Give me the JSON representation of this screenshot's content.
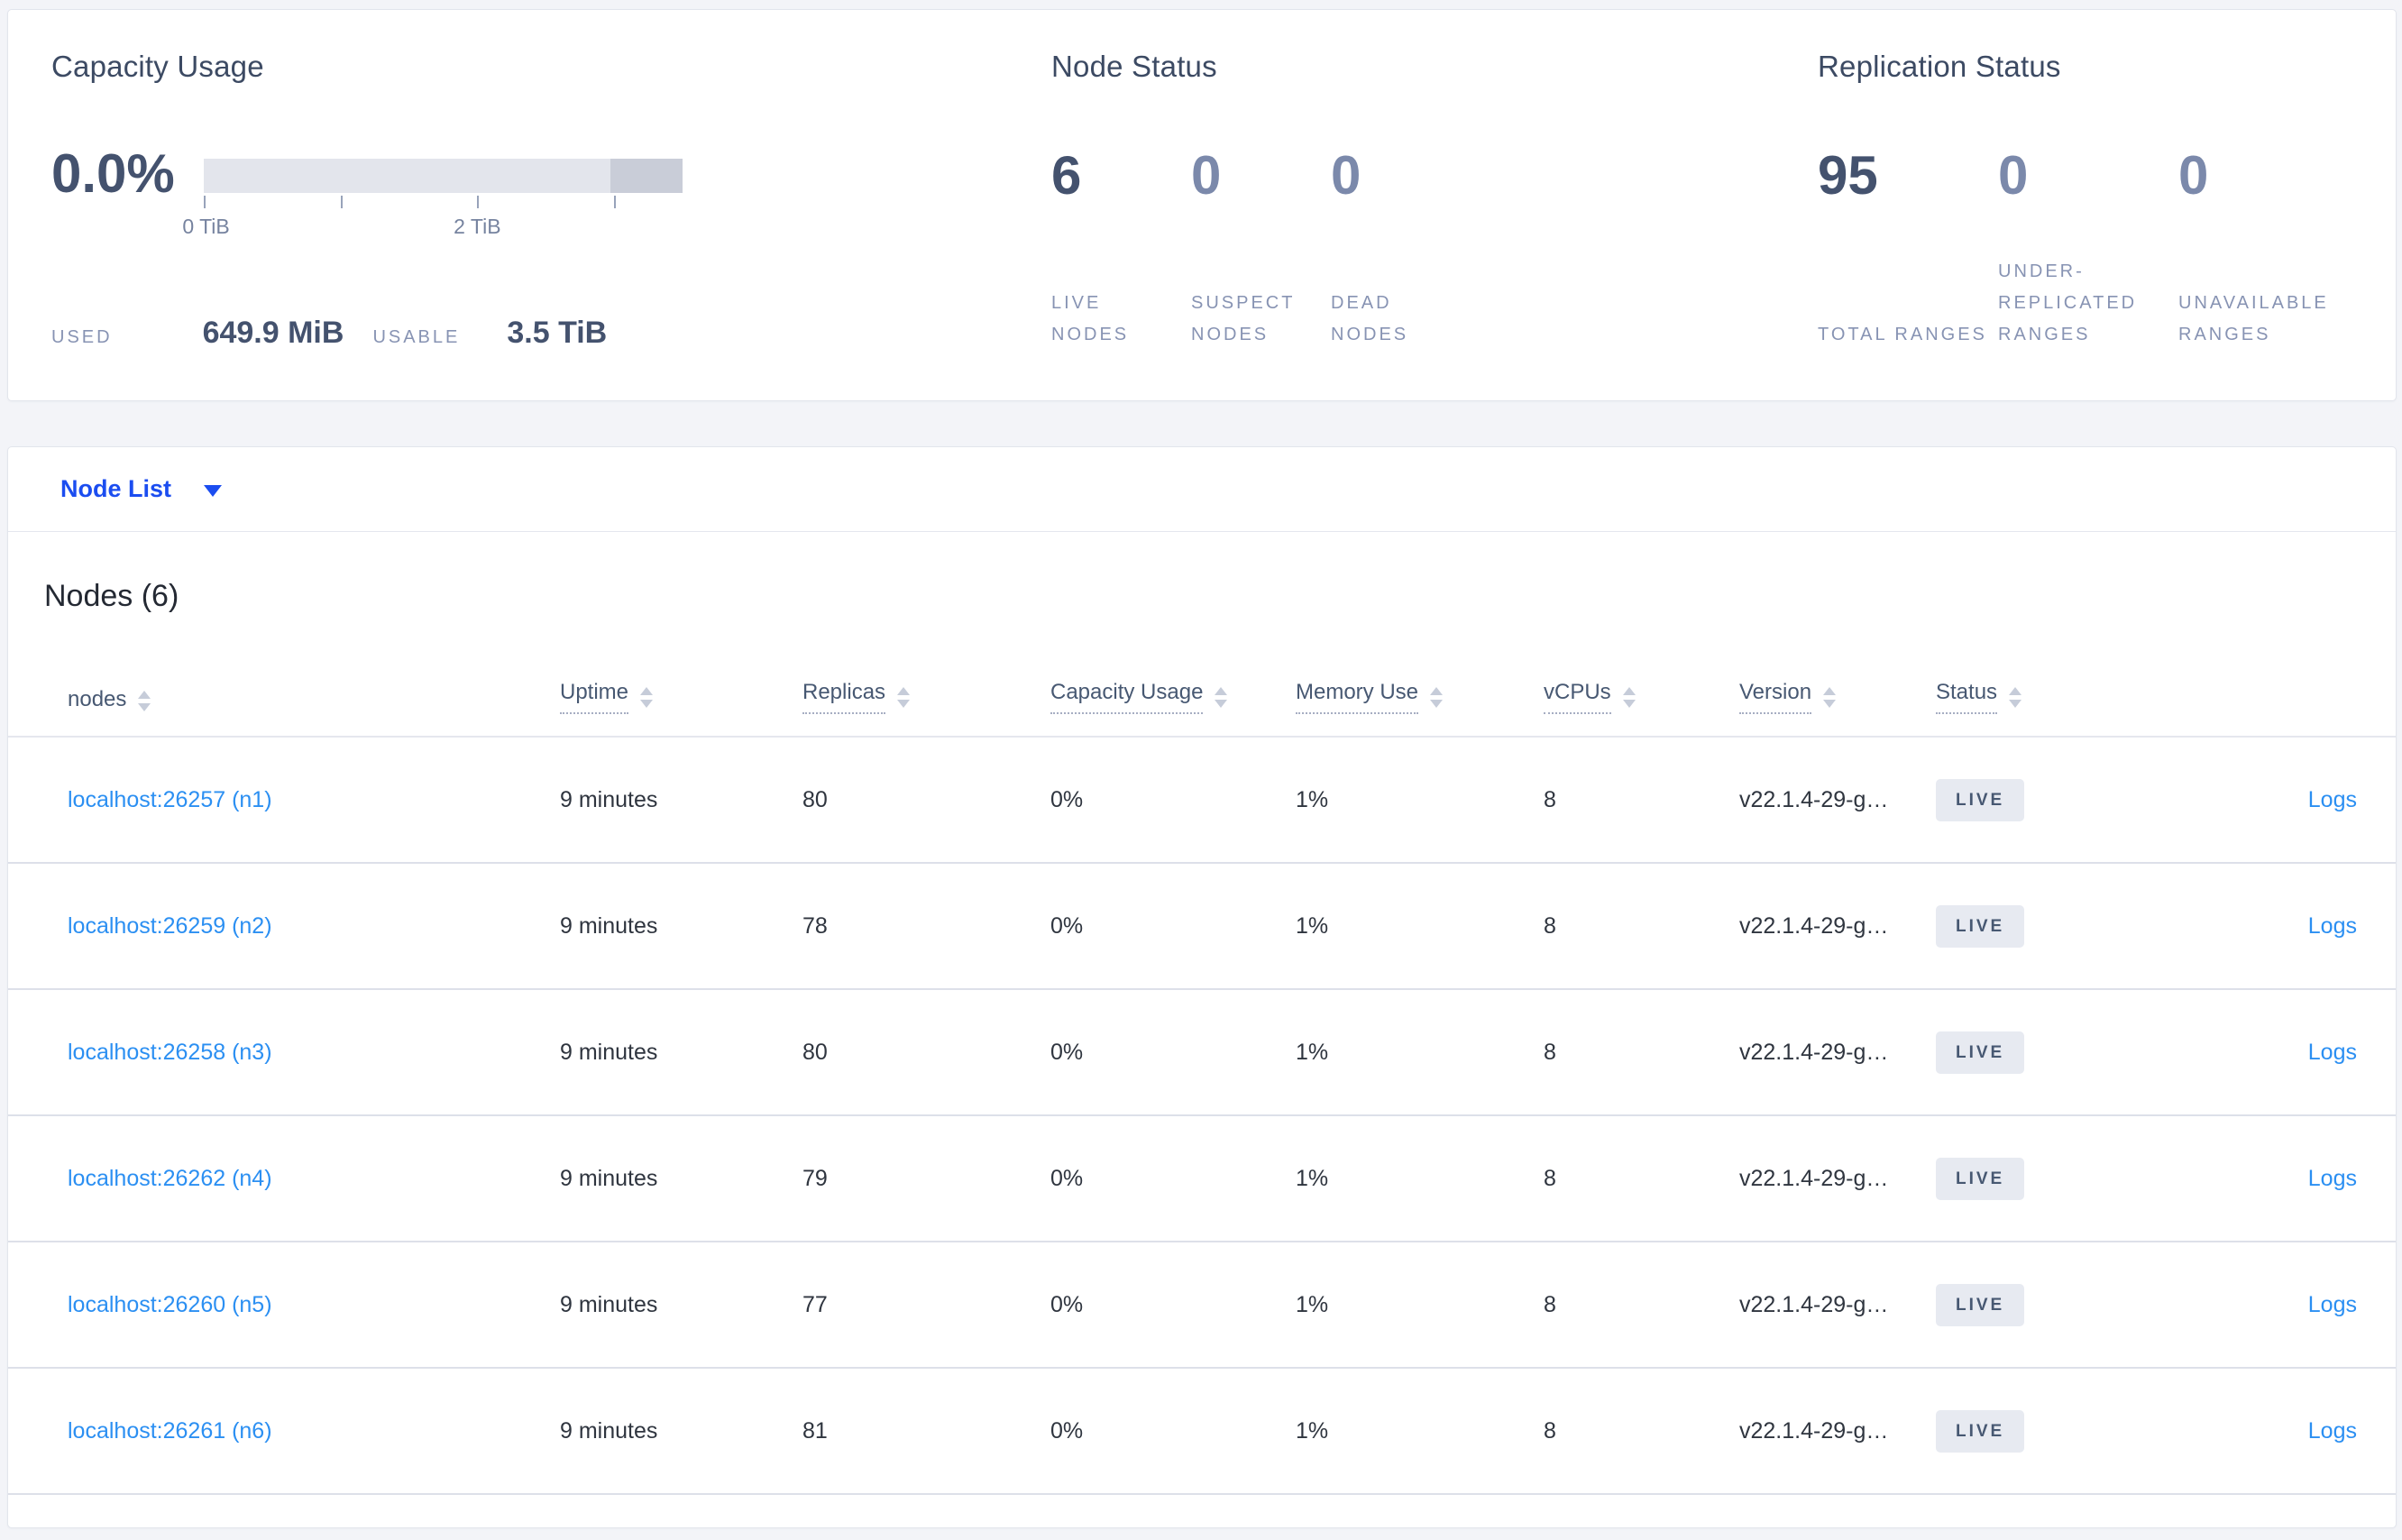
{
  "colors": {
    "accent_blue": "#1b4df0",
    "link_blue": "#2b8ff2",
    "badge_bg": "#e7eaf1",
    "badge_text": "#475872",
    "gauge_light": "#e3e5ec",
    "gauge_dark": "#c9cdd8"
  },
  "summary": {
    "capacity": {
      "title": "Capacity Usage",
      "percent": "0.0%",
      "tick_label_0": "0 TiB",
      "tick_label_2": "2 TiB",
      "used_label": "USED",
      "used_value": "649.9 MiB",
      "usable_label": "USABLE",
      "usable_value": "3.5 TiB"
    },
    "node_status": {
      "title": "Node Status",
      "stats": [
        {
          "value": "6",
          "label": "LIVE NODES",
          "dim": false
        },
        {
          "value": "0",
          "label": "SUSPECT NODES",
          "dim": true
        },
        {
          "value": "0",
          "label": "DEAD NODES",
          "dim": true
        }
      ]
    },
    "replication": {
      "title": "Replication Status",
      "stats": [
        {
          "value": "95",
          "label": "TOTAL RANGES",
          "dim": false
        },
        {
          "value": "0",
          "label": "UNDER-REPLICATED RANGES",
          "dim": true
        },
        {
          "value": "0",
          "label": "UNAVAILABLE RANGES",
          "dim": true
        }
      ]
    }
  },
  "nav": {
    "dropdown_label": "Node List"
  },
  "table": {
    "title": "Nodes (6)",
    "logs_label": "Logs",
    "columns": [
      {
        "label": "nodes",
        "underline": false
      },
      {
        "label": "Uptime",
        "underline": true
      },
      {
        "label": "Replicas",
        "underline": true
      },
      {
        "label": "Capacity Usage",
        "underline": true
      },
      {
        "label": "Memory Use",
        "underline": true
      },
      {
        "label": "vCPUs",
        "underline": true
      },
      {
        "label": "Version",
        "underline": true
      },
      {
        "label": "Status",
        "underline": true
      }
    ],
    "rows": [
      {
        "node": "localhost:26257 (n1)",
        "uptime": "9 minutes",
        "replicas": "80",
        "capacity": "0%",
        "memory": "1%",
        "vcpus": "8",
        "version": "v22.1.4-29-g…",
        "status": "LIVE"
      },
      {
        "node": "localhost:26259 (n2)",
        "uptime": "9 minutes",
        "replicas": "78",
        "capacity": "0%",
        "memory": "1%",
        "vcpus": "8",
        "version": "v22.1.4-29-g…",
        "status": "LIVE"
      },
      {
        "node": "localhost:26258 (n3)",
        "uptime": "9 minutes",
        "replicas": "80",
        "capacity": "0%",
        "memory": "1%",
        "vcpus": "8",
        "version": "v22.1.4-29-g…",
        "status": "LIVE"
      },
      {
        "node": "localhost:26262 (n4)",
        "uptime": "9 minutes",
        "replicas": "79",
        "capacity": "0%",
        "memory": "1%",
        "vcpus": "8",
        "version": "v22.1.4-29-g…",
        "status": "LIVE"
      },
      {
        "node": "localhost:26260 (n5)",
        "uptime": "9 minutes",
        "replicas": "77",
        "capacity": "0%",
        "memory": "1%",
        "vcpus": "8",
        "version": "v22.1.4-29-g…",
        "status": "LIVE"
      },
      {
        "node": "localhost:26261 (n6)",
        "uptime": "9 minutes",
        "replicas": "81",
        "capacity": "0%",
        "memory": "1%",
        "vcpus": "8",
        "version": "v22.1.4-29-g…",
        "status": "LIVE"
      }
    ]
  }
}
